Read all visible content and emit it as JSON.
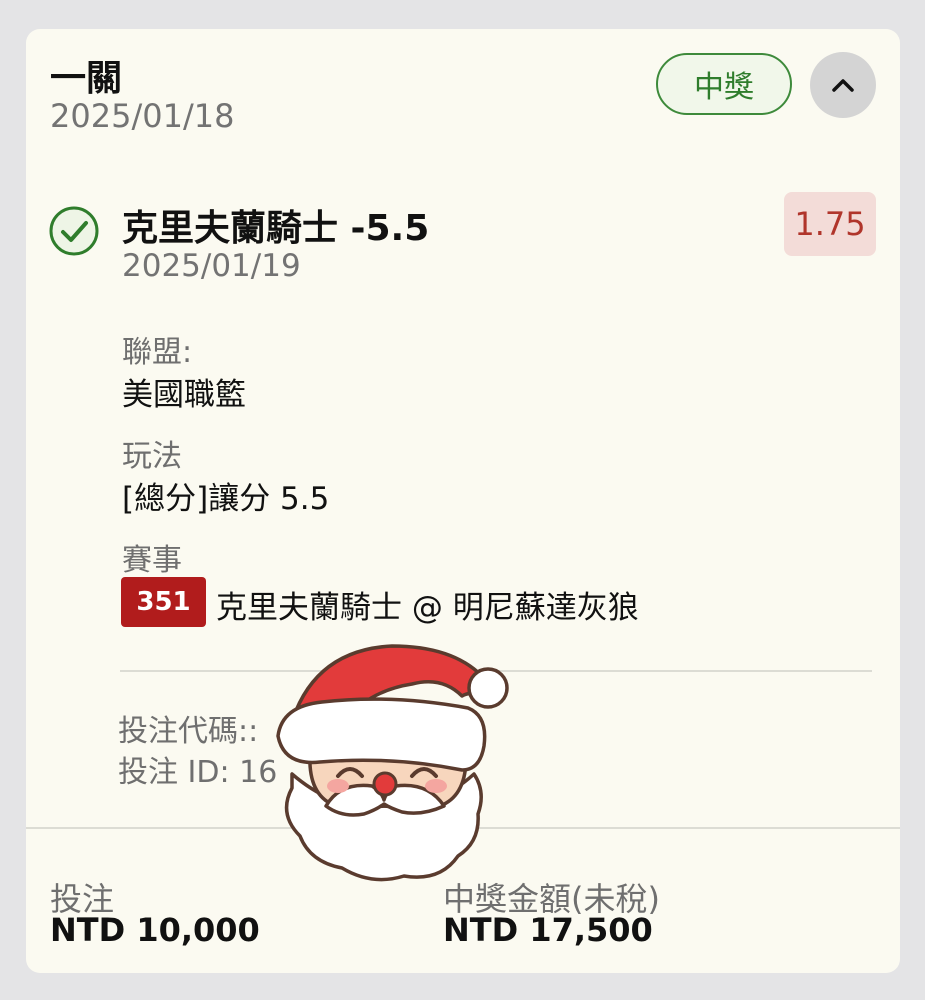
{
  "header": {
    "bet_type": "一關",
    "date": "2025/01/18",
    "status": "中獎"
  },
  "selection": {
    "title": "克里夫蘭騎士 -5.5",
    "date": "2025/01/19",
    "odds": "1.75"
  },
  "details": {
    "league_label": "聯盟:",
    "league_value": "美國職籃",
    "market_label": "玩法",
    "market_value": "[總分]讓分 5.5",
    "event_label": "賽事",
    "event_number": "351",
    "event_name": "克里夫蘭騎士 @ 明尼蘇達灰狼"
  },
  "refs": {
    "bet_code": "投注代碼::",
    "bet_id": "投注 ID: 16"
  },
  "footer": {
    "stake_label": "投注",
    "stake_value": "NTD 10,000",
    "payout_label": "中獎金額(未稅)",
    "payout_value": "NTD 17,500"
  },
  "colors": {
    "win_green": "#2f7d2c",
    "odds_red": "#b0352b",
    "event_red": "#b11c1c"
  },
  "icons": {
    "status": "check-circle-icon",
    "collapse": "chevron-up-icon",
    "sticker": "santa-sticker"
  }
}
